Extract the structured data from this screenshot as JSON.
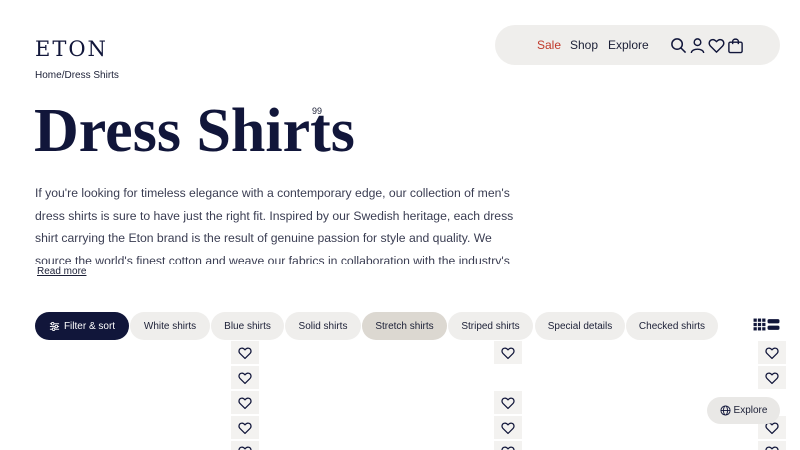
{
  "brand": {
    "logo": "ETON"
  },
  "breadcrumb": {
    "home": "Home",
    "separator": "/",
    "current": "Dress Shirts"
  },
  "nav": {
    "sale": "Sale",
    "shop": "Shop",
    "explore": "Explore",
    "sale_color": "#c0392b"
  },
  "page": {
    "title": "Dress Shirts",
    "count": "99",
    "description": "If you're looking for timeless elegance with a contemporary edge, our collection of men's dress shirts is sure to have just the right fit. Inspired by our Swedish heritage, each dress shirt carrying the Eton brand is the result of genuine passion for style and quality. We source the world's finest cotton and weave our fabrics in collaboration with the industry's most renowned",
    "read_more": "Read more"
  },
  "filters": {
    "filter_sort": "Filter & sort",
    "chips": [
      "White shirts",
      "Blue shirts",
      "Solid shirts",
      "Stretch shirts",
      "Striped shirts",
      "Special details",
      "Checked shirts"
    ],
    "active": "Stretch shirts"
  },
  "floating": {
    "explore": "Explore"
  },
  "icons": [
    "search-icon",
    "user-icon",
    "heart-icon",
    "bag-icon",
    "sliders-icon",
    "grid-icon",
    "list-icon",
    "globe-icon"
  ],
  "colors": {
    "primary": "#11163a",
    "chip": "#efeeec",
    "chip_active": "#dcd8d1"
  }
}
